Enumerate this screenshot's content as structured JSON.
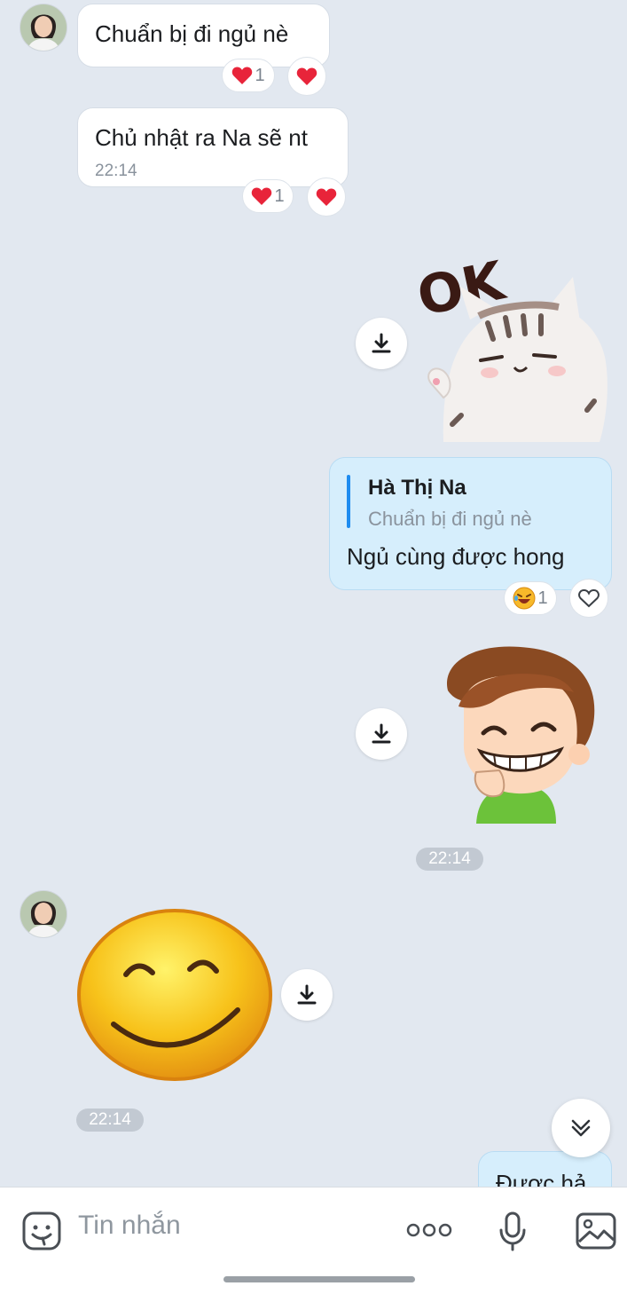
{
  "messages": {
    "m1": {
      "text": "Chuẩn bị đi ngủ nè",
      "reaction_count": "1"
    },
    "m2": {
      "text": "Chủ nhật ra Na sẽ nt",
      "time": "22:14",
      "reaction_count": "1"
    },
    "sticker_ok": {
      "label": "OK"
    },
    "reply": {
      "quote_name": "Hà Thị Na",
      "quote_text": "Chuẩn bị đi ngủ nè",
      "text": "Ngủ cùng được hong",
      "reaction_count": "1"
    },
    "time_chip_1": "22:14",
    "time_chip_2": "22:14",
    "partial": {
      "text": "Được hả"
    }
  },
  "composer": {
    "placeholder": "Tin nhắn"
  },
  "colors": {
    "background": "#e2e8f0",
    "incoming_bubble": "#ffffff",
    "outgoing_bubble": "#d6eefc",
    "accent": "#1e8cf0",
    "heart": "#e8243a"
  }
}
